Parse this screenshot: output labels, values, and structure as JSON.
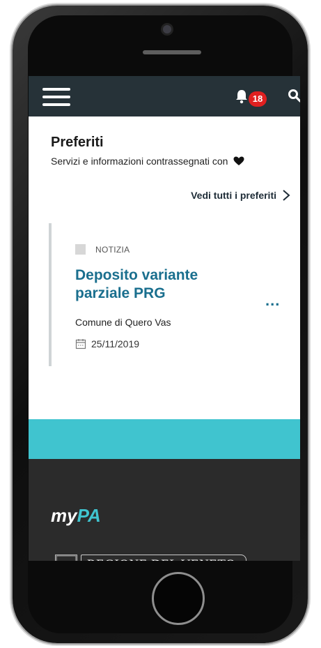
{
  "header": {
    "notification_count": "18"
  },
  "favorites": {
    "title": "Preferiti",
    "subtitle": "Servizi e informazioni contrassegnati con",
    "see_all_label": "Vedi tutti i preferiti"
  },
  "card": {
    "type_label": "NOTIZIA",
    "title": "Deposito variante parziale PRG",
    "more_label": "...",
    "organization": "Comune di Quero Vas",
    "date": "25/11/2019"
  },
  "footer": {
    "logo_text_my": "my",
    "logo_text_pa": "PA",
    "region_name": "REGIONE DEL VENETO"
  },
  "icons": {
    "menu": "hamburger-icon",
    "notifications": "bell-icon",
    "search": "search-icon",
    "favorite": "heart-icon",
    "see_all": "chevron-right-icon",
    "date": "calendar-icon"
  },
  "colors": {
    "topbar": "#263238",
    "accent": "#1a6f8e",
    "teal": "#40c4cf",
    "badge": "#e02020",
    "footer": "#2b2b2b"
  }
}
